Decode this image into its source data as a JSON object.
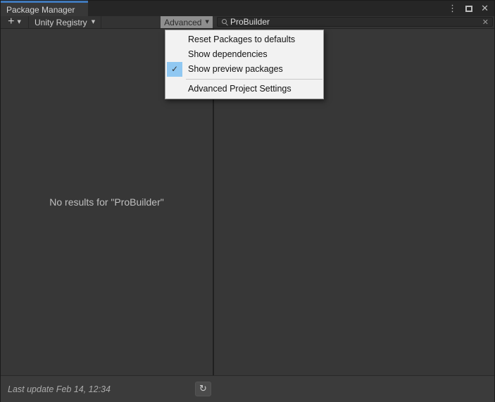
{
  "window": {
    "tab_label": "Package Manager"
  },
  "icons": {
    "kebab": "⋮",
    "close": "✕",
    "plus": "+",
    "chevron_down": "▼",
    "check": "✓",
    "search_clear": "✕",
    "refresh": "↻"
  },
  "toolbar": {
    "registry_label": "Unity Registry",
    "advanced_label": "Advanced",
    "search_value": "ProBuilder"
  },
  "menu": {
    "items": [
      {
        "label": "Reset Packages to defaults",
        "checked": false
      },
      {
        "label": "Show dependencies",
        "checked": false
      },
      {
        "label": "Show preview packages",
        "checked": true
      },
      {
        "label": "Advanced Project Settings",
        "checked": false
      }
    ]
  },
  "main": {
    "empty_message": "No results for \"ProBuilder\""
  },
  "statusbar": {
    "last_update_label": "Last update Feb 14, 12:34"
  },
  "colors": {
    "tab_accent": "#4079ba",
    "menu_check_bg": "#90c8f2",
    "panel_bg": "#373737",
    "menu_bg": "#f2f2f2"
  }
}
